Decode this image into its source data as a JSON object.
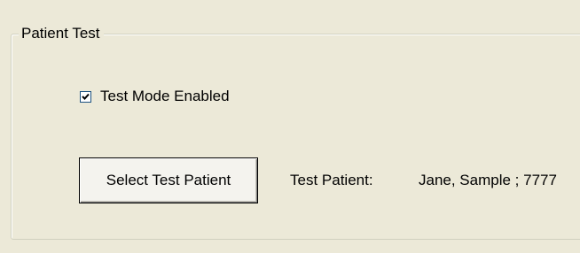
{
  "group": {
    "title": "Patient Test"
  },
  "test_mode": {
    "label": "Test Mode Enabled",
    "checked": true
  },
  "select_button": {
    "label": "Select Test Patient"
  },
  "test_patient": {
    "label": "Test Patient:",
    "value": "Jane, Sample ; 7777"
  },
  "icons": {
    "checkmark": "checkmark-icon"
  },
  "colors": {
    "background": "#ece9d8",
    "checkbox_border": "#1c5180",
    "groupbox_border": "#d0d0bf"
  }
}
